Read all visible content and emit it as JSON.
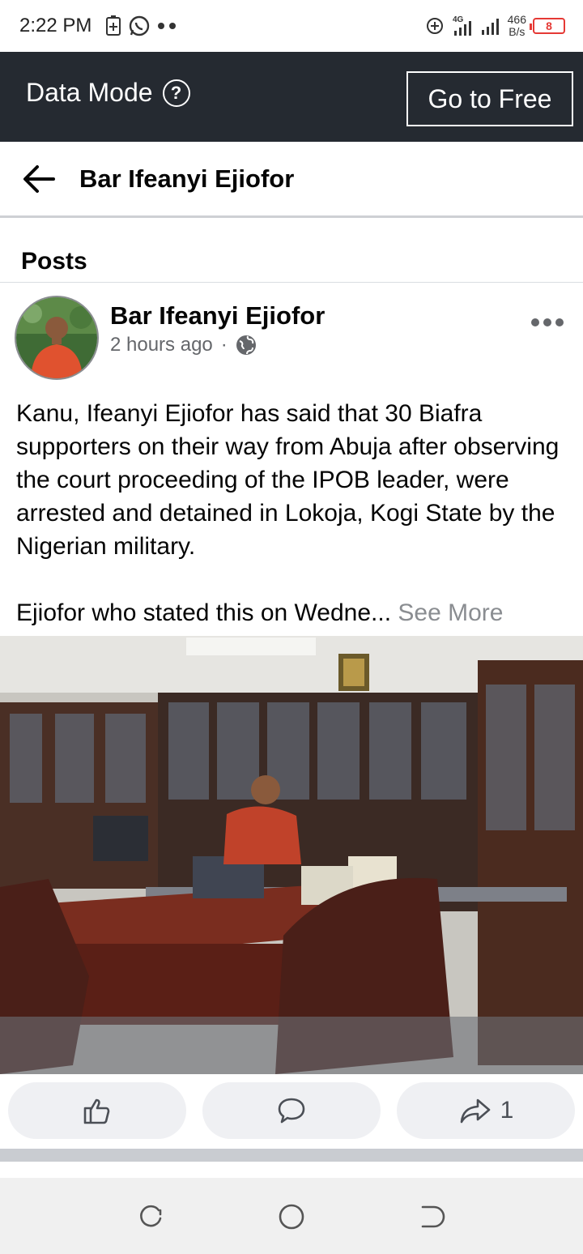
{
  "status_bar": {
    "time": "2:22 PM",
    "network": "4G",
    "speed_value": "466",
    "speed_unit": "B/s",
    "battery": "8",
    "battery_color": "#e53935"
  },
  "data_banner": {
    "label": "Data Mode",
    "help": "?",
    "button": "Go to Free"
  },
  "header": {
    "title": "Bar Ifeanyi Ejiofor"
  },
  "posts_section": {
    "heading": "Posts"
  },
  "post": {
    "author": "Bar Ifeanyi Ejiofor",
    "time": "2 hours ago",
    "separator": "·",
    "paragraph1": "Kanu, Ifeanyi Ejiofor has said that 30 Biafra supporters on their way from Abuja after observing the court proceeding of the IPOB leader, were arrested and detained in Lokoja, Kogi State by the Nigerian military.",
    "paragraph2": "Ejiofor who stated this on Wedne...",
    "see_more": "See More",
    "share_count": "1"
  },
  "icons": {
    "back": "arrow-left-icon",
    "more": "more-horizontal-icon",
    "privacy": "globe-icon",
    "like": "thumbs-up-icon",
    "comment": "comment-icon",
    "share": "share-icon"
  },
  "colors": {
    "banner": "#252a31",
    "secondary_text": "#65676b",
    "action_bg": "#eff0f3"
  }
}
